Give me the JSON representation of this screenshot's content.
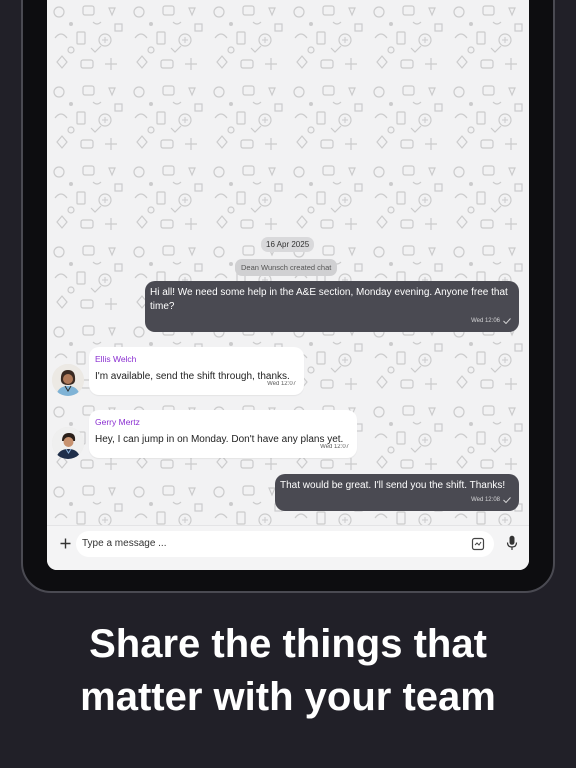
{
  "chat": {
    "date_separator": "16 Apr 2025",
    "system_message": "Dean Wunsch created chat",
    "messages": [
      {
        "direction": "outgoing",
        "text": "Hi all! We need some help in the A&E section, Monday evening. Anyone free that time?",
        "time": "Wed 12:06",
        "status_icon": "check-icon"
      },
      {
        "direction": "incoming",
        "sender": "Ellis Welch",
        "text": "I'm available, send the shift through, thanks.",
        "time": "Wed 12:07"
      },
      {
        "direction": "incoming",
        "sender": "Gerry Mertz",
        "text": "Hey, I can jump in on Monday. Don't have any plans yet.",
        "time": "Wed 12:07"
      },
      {
        "direction": "outgoing",
        "text": "That would be great. I'll send you the shift. Thanks!",
        "time": "Wed 12:08",
        "status_icon": "check-icon"
      }
    ]
  },
  "composer": {
    "placeholder": "Type a message ...",
    "attach_icon": "plus-icon",
    "sticker_icon": "sticker-icon",
    "mic_icon": "microphone-icon"
  },
  "promo": {
    "headline_line1": "Share the things that",
    "headline_line2": "matter with your team"
  },
  "colors": {
    "background": "#212028",
    "outgoing_bubble": "#4a4a52",
    "incoming_bubble": "#ffffff",
    "sender_name": "#8a2ed1",
    "chat_background": "#f2f2f3"
  }
}
